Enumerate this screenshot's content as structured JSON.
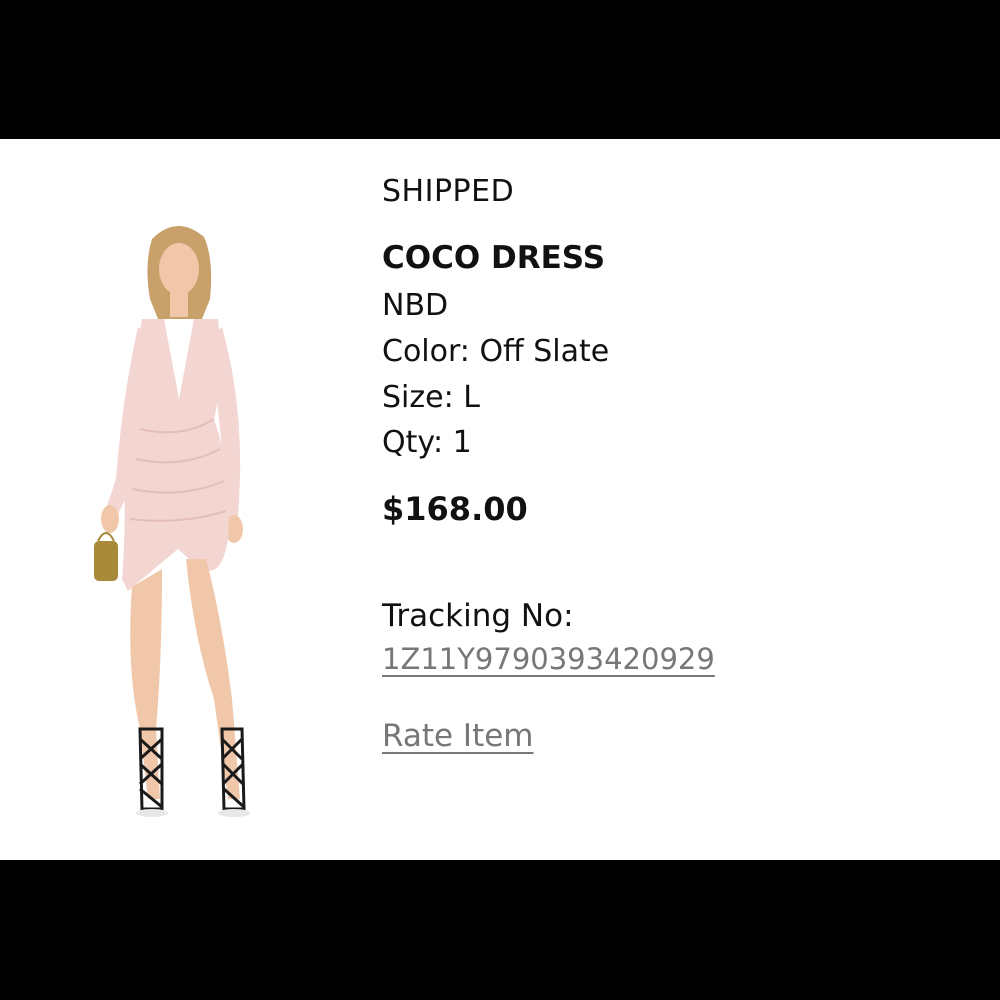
{
  "order_item": {
    "status": "SHIPPED",
    "product_name": "COCO DRESS",
    "brand": "NBD",
    "color_line": "Color: Off Slate",
    "size_line": "Size: L",
    "qty_line": "Qty: 1",
    "price": "$168.00",
    "tracking_label": "Tracking No:",
    "tracking_number": "1Z11Y9790393420929",
    "rate_item_label": "Rate Item"
  },
  "colors": {
    "background": "#000000",
    "card": "#ffffff",
    "text": "#111111",
    "link": "#777777",
    "dress": "#f3d6d2",
    "skin": "#f0c7a8",
    "hair": "#c8a06a",
    "heels": "#1a1a1a",
    "clutch": "#a88a3a"
  },
  "image": {
    "icon": "dress-model-photo"
  }
}
